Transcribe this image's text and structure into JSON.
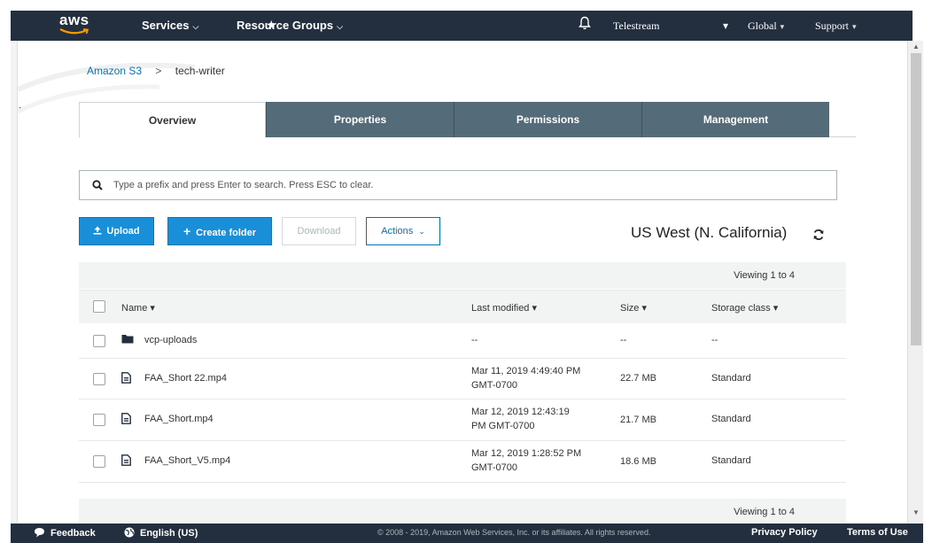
{
  "nav": {
    "logo_text": "aws",
    "services": "Services",
    "resource_groups": "Resource Groups",
    "account": "Telestream",
    "region": "Global",
    "support": "Support"
  },
  "breadcrumb": {
    "root": "Amazon S3",
    "separator": ">",
    "current": "tech-writer"
  },
  "tabs": [
    {
      "label": "Overview",
      "active": true
    },
    {
      "label": "Properties",
      "active": false
    },
    {
      "label": "Permissions",
      "active": false
    },
    {
      "label": "Management",
      "active": false
    }
  ],
  "search": {
    "placeholder": "Type a prefix and press Enter to search. Press ESC to clear."
  },
  "toolbar": {
    "upload": "Upload",
    "create_folder": "Create folder",
    "download": "Download",
    "actions": "Actions",
    "region": "US West (N. California)"
  },
  "table": {
    "viewing_top": "Viewing 1 to 4",
    "viewing_bottom": "Viewing 1 to 4",
    "headers": {
      "name": "Name",
      "last_modified": "Last modified",
      "size": "Size",
      "storage_class": "Storage class"
    },
    "rows": [
      {
        "type": "folder",
        "name": "vcp-uploads",
        "modified_1": "--",
        "modified_2": "",
        "size": "--",
        "storage": "--"
      },
      {
        "type": "file",
        "name": "FAA_Short 22.mp4",
        "modified_1": "Mar 11, 2019 4:49:40 PM",
        "modified_2": "GMT-0700",
        "size": "22.7 MB",
        "storage": "Standard"
      },
      {
        "type": "file",
        "name": "FAA_Short.mp4",
        "modified_1": "Mar 12, 2019 12:43:19",
        "modified_2": "PM GMT-0700",
        "size": "21.7 MB",
        "storage": "Standard"
      },
      {
        "type": "file",
        "name": "FAA_Short_V5.mp4",
        "modified_1": "Mar 12, 2019 1:28:52 PM",
        "modified_2": "GMT-0700",
        "size": "18.6 MB",
        "storage": "Standard"
      }
    ]
  },
  "footer": {
    "feedback": "Feedback",
    "language": "English (US)",
    "copyright": "© 2008 - 2019, Amazon Web Services, Inc. or its affiliates. All rights reserved.",
    "privacy": "Privacy Policy",
    "terms": "Terms of Use"
  },
  "colors": {
    "nav_bg": "#232f3e",
    "tab_inactive_bg": "#546b7a",
    "primary_button": "#1a8fd9",
    "link": "#0073bb"
  },
  "icons": {
    "pin": "pin-icon",
    "notifications": "bell-icon",
    "search": "search-icon",
    "upload": "upload-icon",
    "create_folder": "plus-icon",
    "refresh": "refresh-icon",
    "folder": "folder-icon",
    "file": "file-icon",
    "feedback": "speech-bubble-icon",
    "language": "globe-icon"
  }
}
